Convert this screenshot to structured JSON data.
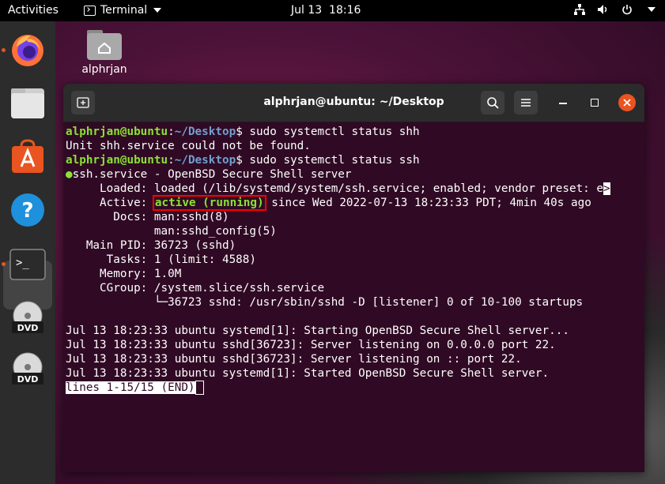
{
  "topbar": {
    "activities": "Activities",
    "app_name": "Terminal",
    "clock": "Jul 13  18:16"
  },
  "desktop": {
    "home_label": "alphrjan"
  },
  "dock": {
    "items": [
      "firefox-icon",
      "files-icon",
      "software-icon",
      "help-icon",
      "terminal-icon",
      "dvd-icon",
      "dvd-icon"
    ]
  },
  "window": {
    "title": "alphrjan@ubuntu: ~/Desktop"
  },
  "terminal": {
    "prompt_user": "alphrjan@ubuntu",
    "prompt_sep": ":",
    "prompt_path": "~/Desktop",
    "prompt_dollar": "$",
    "cmd1": " sudo systemctl status shh",
    "out1": "Unit shh.service could not be found.",
    "cmd2": " sudo systemctl status ssh",
    "service_dot": "●",
    "service_line": "ssh.service - OpenBSD Secure Shell server",
    "loaded_label": "     Loaded: ",
    "loaded_value": "loaded (/lib/systemd/system/ssh.service; enabled; vendor preset: e",
    "overflow_marker": ">",
    "active_label": "     Active: ",
    "active_value": "active (running)",
    "active_rest": " since Wed 2022-07-13 18:23:33 PDT; 4min 40s ago",
    "docs_label": "       Docs: ",
    "docs_1": "man:sshd(8)",
    "docs_2_indent": "             ",
    "docs_2": "man:sshd_config(5)",
    "pid_line": "   Main PID: 36723 (sshd)",
    "tasks_line": "      Tasks: 1 (limit: 4588)",
    "memory_line": "     Memory: 1.0M",
    "cgroup_line": "     CGroup: /system.slice/ssh.service",
    "cgroup_child": "             └─36723 sshd: /usr/sbin/sshd -D [listener] 0 of 10-100 startups",
    "log": [
      "Jul 13 18:23:33 ubuntu systemd[1]: Starting OpenBSD Secure Shell server...",
      "Jul 13 18:23:33 ubuntu sshd[36723]: Server listening on 0.0.0.0 port 22.",
      "Jul 13 18:23:33 ubuntu sshd[36723]: Server listening on :: port 22.",
      "Jul 13 18:23:33 ubuntu systemd[1]: Started OpenBSD Secure Shell server."
    ],
    "pager_status": "lines 1-15/15 (END)"
  },
  "colors": {
    "terminal_bg": "#300a24",
    "prompt_user": "#8ae234",
    "prompt_path": "#729fcf",
    "highlight_box": "#ff0000",
    "accent": "#e95420"
  }
}
